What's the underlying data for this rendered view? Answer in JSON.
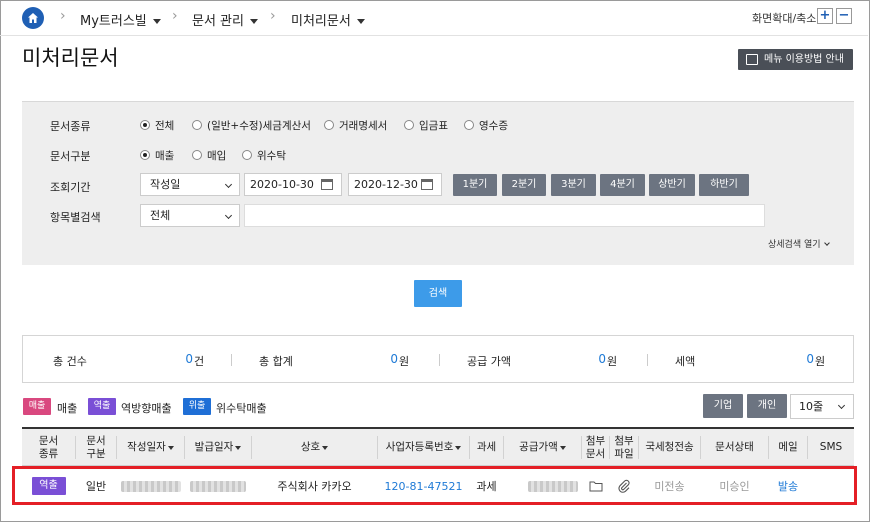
{
  "breadcrumb": {
    "items": [
      {
        "label": "My트러스빌"
      },
      {
        "label": "문서 관리"
      },
      {
        "label": "미처리문서"
      }
    ]
  },
  "zoom": {
    "label": "화면확대/축소",
    "in": "+",
    "out": "−"
  },
  "page": {
    "title": "미처리문서",
    "guide_label": "메뉴 이용방법 안내"
  },
  "filters": {
    "doc_type": {
      "label": "문서종류",
      "options": [
        "전체",
        "(일반+수정)세금계산서",
        "거래명세서",
        "입금표",
        "영수증"
      ],
      "selected": "전체"
    },
    "doc_class": {
      "label": "문서구분",
      "options": [
        "매출",
        "매입",
        "위수탁"
      ],
      "selected": "매출"
    },
    "period": {
      "label": "조회기간",
      "basis": "작성일",
      "start": "2020-10-30",
      "tilde": "~",
      "end": "2020-12-30",
      "quick": [
        "1분기",
        "2분기",
        "3분기",
        "4분기",
        "상반기",
        "하반기"
      ]
    },
    "item_search": {
      "label": "항목별검색",
      "field": "전체",
      "value": ""
    },
    "advanced": "상세검색 열기"
  },
  "search_button": "검색",
  "summary": {
    "count": {
      "label": "총 건수",
      "value": "0",
      "unit": "건"
    },
    "total": {
      "label": "총 합계",
      "value": "0",
      "unit": "원"
    },
    "supply": {
      "label": "공급 가액",
      "value": "0",
      "unit": "원"
    },
    "tax": {
      "label": "세액",
      "value": "0",
      "unit": "원"
    }
  },
  "legend": [
    {
      "badge": "매출",
      "text": "매출",
      "color": "#d9487f"
    },
    {
      "badge": "역출",
      "text": "역방향매출",
      "color": "#7a4fd6"
    },
    {
      "badge": "위출",
      "text": "위수탁매출",
      "color": "#1f6fd6"
    }
  ],
  "table_controls": {
    "company": "기업",
    "personal": "개인",
    "page_size": "10줄"
  },
  "table": {
    "headers": [
      {
        "l1": "문서",
        "l2": "종류"
      },
      {
        "l1": "문서",
        "l2": "구분"
      },
      {
        "l1": "작성일자",
        "sort": true
      },
      {
        "l1": "발급일자",
        "sort": true
      },
      {
        "l1": "상호",
        "sort": true
      },
      {
        "l1": "사업자등록번호",
        "sort": true
      },
      {
        "l1": "과세"
      },
      {
        "l1": "공급가액",
        "sort": true
      },
      {
        "l1": "첨부",
        "l2": "문서"
      },
      {
        "l1": "첨부",
        "l2": "파일"
      },
      {
        "l1": "국세청전송"
      },
      {
        "l1": "문서상태"
      },
      {
        "l1": "메일"
      },
      {
        "l1": "SMS"
      }
    ],
    "rows": [
      {
        "type_badge": "역출",
        "doc_class": "일반",
        "company": "주식회사 카카오",
        "biz_no": "120-81-47521",
        "tax": "과세",
        "nts": "미전송",
        "status": "미승인",
        "mail": "발송",
        "sms": ""
      }
    ]
  },
  "colors": {
    "accent": "#1f5fb4",
    "link": "#1f7ad6",
    "search_button": "#3d9be9",
    "quick_button": "#6c7481",
    "highlight": "#e41f26"
  }
}
